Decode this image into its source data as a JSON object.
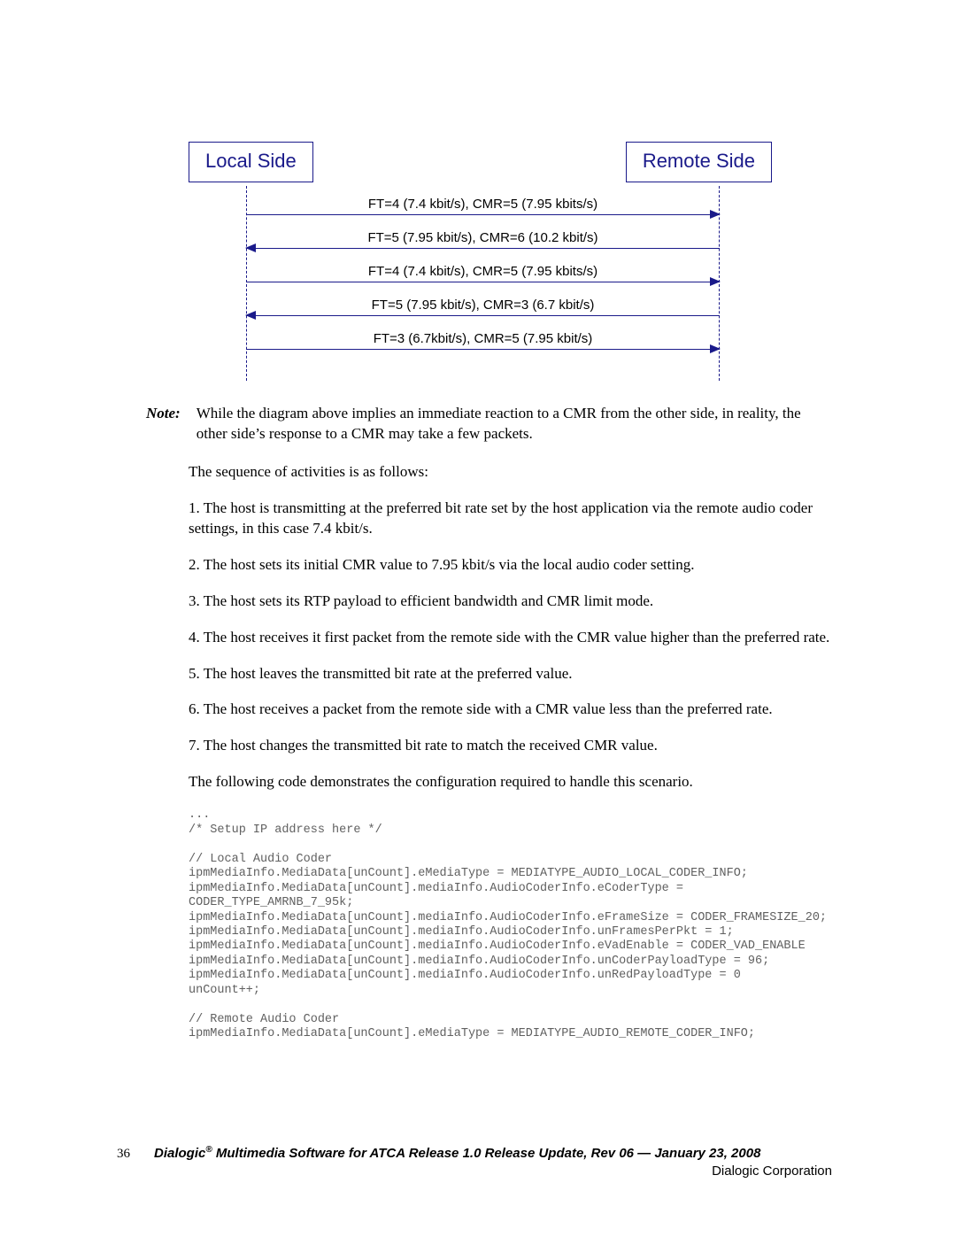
{
  "diagram": {
    "local_label": "Local Side",
    "remote_label": "Remote Side",
    "rows": [
      {
        "text": "FT=4 (7.4 kbit/s), CMR=5 (7.95 kbits/s)",
        "dir": "right"
      },
      {
        "text": "FT=5 (7.95 kbit/s), CMR=6 (10.2 kbit/s)",
        "dir": "left"
      },
      {
        "text": "FT=4 (7.4 kbit/s), CMR=5 (7.95 kbits/s)",
        "dir": "right"
      },
      {
        "text": "FT=5 (7.95 kbit/s), CMR=3 (6.7 kbit/s)",
        "dir": "left"
      },
      {
        "text": "FT=3 (6.7kbit/s), CMR=5 (7.95 kbit/s)",
        "dir": "right"
      }
    ]
  },
  "note": {
    "label": "Note:",
    "text": "While the diagram above implies an immediate reaction to a CMR from the other side, in reality, the other side’s response to a CMR may take a few packets."
  },
  "paragraphs": [
    "The sequence of activities is as follows:",
    "1. The host is transmitting at the preferred bit rate set by the host application via the remote audio coder settings, in this case 7.4 kbit/s.",
    "2. The host sets its initial CMR value to 7.95 kbit/s via the local audio coder setting.",
    "3. The host sets its RTP payload to efficient bandwidth and CMR limit mode.",
    "4. The host receives it first packet from the remote side with the CMR value higher than the preferred rate.",
    "5. The host leaves the transmitted bit rate at the preferred value.",
    "6. The host receives a packet from the remote side with a CMR value less than the preferred rate.",
    "7. The host changes the transmitted bit rate to match the received CMR value.",
    "The following code demonstrates the configuration required to handle this scenario."
  ],
  "code": "...\n/* Setup IP address here */\n\n// Local Audio Coder\nipmMediaInfo.MediaData[unCount].eMediaType = MEDIATYPE_AUDIO_LOCAL_CODER_INFO;\nipmMediaInfo.MediaData[unCount].mediaInfo.AudioCoderInfo.eCoderType =\nCODER_TYPE_AMRNB_7_95k;\nipmMediaInfo.MediaData[unCount].mediaInfo.AudioCoderInfo.eFrameSize = CODER_FRAMESIZE_20;\nipmMediaInfo.MediaData[unCount].mediaInfo.AudioCoderInfo.unFramesPerPkt = 1;\nipmMediaInfo.MediaData[unCount].mediaInfo.AudioCoderInfo.eVadEnable = CODER_VAD_ENABLE\nipmMediaInfo.MediaData[unCount].mediaInfo.AudioCoderInfo.unCoderPayloadType = 96;\nipmMediaInfo.MediaData[unCount].mediaInfo.AudioCoderInfo.unRedPayloadType = 0\nunCount++;\n\n// Remote Audio Coder\nipmMediaInfo.MediaData[unCount].eMediaType = MEDIATYPE_AUDIO_REMOTE_CODER_INFO;",
  "footer": {
    "page": "36",
    "title_prefix": "Dialogic",
    "title_rest": " Multimedia Software for ATCA Release 1.0 Release Update, Rev 06  — January 23, 2008",
    "company": "Dialogic Corporation"
  }
}
